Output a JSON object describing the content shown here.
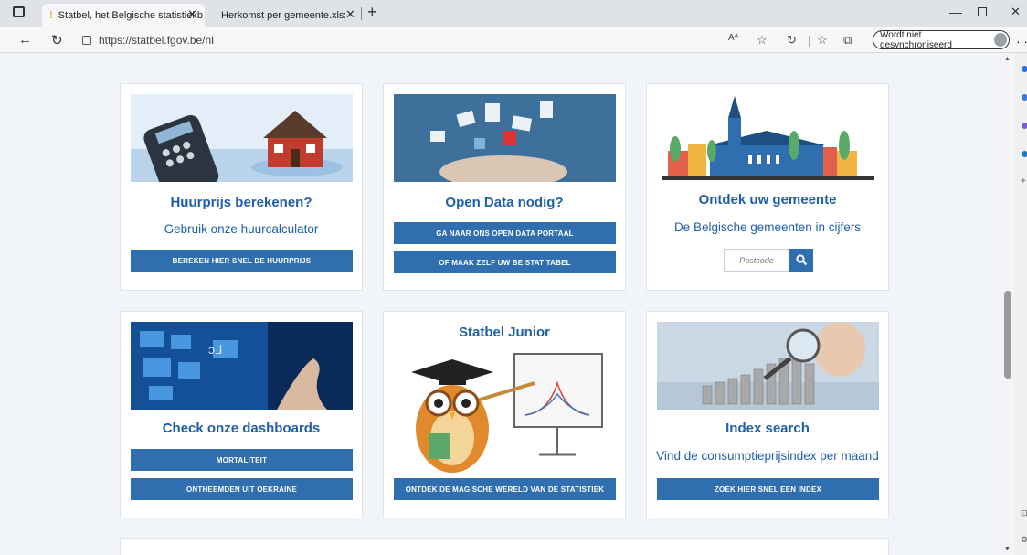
{
  "browser": {
    "tabs": [
      {
        "label": "Statbel, het Belgische statistiekb"
      },
      {
        "label": "Herkomst per gemeente.xlsx"
      }
    ],
    "url": "https://statbel.fgov.be/nl",
    "sync_label": "Wordt niet gesynchroniseerd",
    "reader_icon": "Aᴬ"
  },
  "cards": [
    {
      "title": "Huurprijs berekenen?",
      "subtitle": "Gebruik onze huurcalculator",
      "buttons": [
        "BEREKEN HIER SNEL DE HUURPRIJS"
      ]
    },
    {
      "title": "Open Data nodig?",
      "buttons": [
        "GA NAAR ONS OPEN DATA PORTAAL",
        "OF MAAK ZELF UW BE.STAT TABEL"
      ]
    },
    {
      "title": "Ontdek uw gemeente",
      "subtitle": "De Belgische gemeenten in cijfers",
      "search_placeholder": "Postcode"
    },
    {
      "title": "Check onze dashboards",
      "buttons": [
        "MORTALITEIT",
        "ONTHEEMDEN UIT OEKRAÏNE"
      ]
    },
    {
      "title": "Statbel Junior",
      "buttons": [
        "ONTDEK DE MAGISCHE WERELD VAN DE STATISTIEK"
      ]
    },
    {
      "title": "Index search",
      "subtitle": "Vind de consumptieprijsindex per maand",
      "buttons": [
        "ZOEK HIER SNEL EEN INDEX"
      ]
    }
  ],
  "colors": {
    "accent": "#1f5fa8",
    "button": "#2f6fb0"
  }
}
